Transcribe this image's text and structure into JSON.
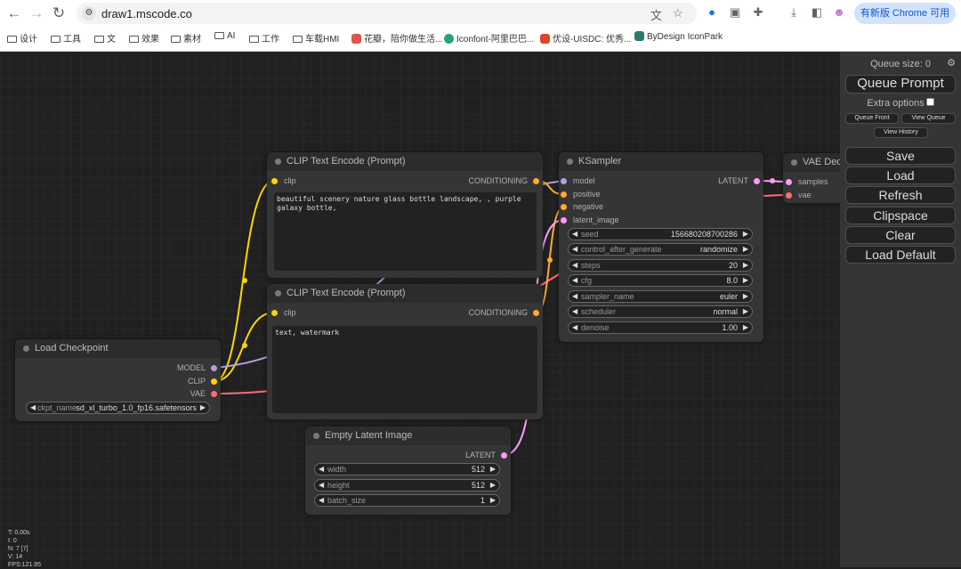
{
  "browser": {
    "url": "draw1.mscode.co",
    "update_label": "有新版 Chrome 可用",
    "bookmarks": [
      {
        "label": "设计",
        "type": "folder"
      },
      {
        "label": "工具",
        "type": "folder"
      },
      {
        "label": "文",
        "type": "folder"
      },
      {
        "label": "效果",
        "type": "folder"
      },
      {
        "label": "素材",
        "type": "folder"
      },
      {
        "label": "AI",
        "type": "folder"
      },
      {
        "label": "工作",
        "type": "folder"
      },
      {
        "label": "车载HMI",
        "type": "folder"
      },
      {
        "label": "花瓣，陪你做生活...",
        "type": "site",
        "color": "#e4504a"
      },
      {
        "label": "Iconfont-阿里巴巴...",
        "type": "site",
        "color": "#2aa37a"
      },
      {
        "label": "优设-UISDC: 优秀...",
        "type": "site",
        "color": "#d8472a"
      },
      {
        "label": "ByDesign IconPark",
        "type": "site",
        "color": "#2c7a6b"
      }
    ]
  },
  "nodes": {
    "clip1": {
      "title": "CLIP Text Encode (Prompt)",
      "input": "clip",
      "output": "CONDITIONING",
      "text": "beautiful scenery nature glass bottle landscape, , purple galaxy bottle,"
    },
    "clip2": {
      "title": "CLIP Text Encode (Prompt)",
      "input": "clip",
      "output": "CONDITIONING",
      "text": "text, watermark"
    },
    "ksampler": {
      "title": "KSampler",
      "inputs": [
        "model",
        "positive",
        "negative",
        "latent_image"
      ],
      "output": "LATENT",
      "widgets": [
        {
          "name": "seed",
          "value": "156680208700286"
        },
        {
          "name": "control_after_generate",
          "value": "randomize"
        },
        {
          "name": "steps",
          "value": "20"
        },
        {
          "name": "cfg",
          "value": "8.0"
        },
        {
          "name": "sampler_name",
          "value": "euler"
        },
        {
          "name": "scheduler",
          "value": "normal"
        },
        {
          "name": "denoise",
          "value": "1.00"
        }
      ]
    },
    "checkpoint": {
      "title": "Load Checkpoint",
      "outputs": [
        "MODEL",
        "CLIP",
        "VAE"
      ],
      "widget": {
        "name": "ckpt_name",
        "value": "sd_xl_turbo_1.0_fp16.safetensors"
      }
    },
    "latent": {
      "title": "Empty Latent Image",
      "output": "LATENT",
      "widgets": [
        {
          "name": "width",
          "value": "512"
        },
        {
          "name": "height",
          "value": "512"
        },
        {
          "name": "batch_size",
          "value": "1"
        }
      ]
    },
    "vae": {
      "title": "VAE Dec",
      "inputs": [
        "samples",
        "vae"
      ]
    }
  },
  "menu": {
    "queue_size": "Queue size: 0",
    "queue_prompt": "Queue Prompt",
    "extra_options": "Extra options",
    "queue_front": "Queue Front",
    "view_queue": "View Queue",
    "view_history": "View History",
    "save": "Save",
    "load": "Load",
    "refresh": "Refresh",
    "clipspace": "Clipspace",
    "clear": "Clear",
    "load_default": "Load Default"
  },
  "stats": [
    "T: 0.00s",
    "I: 0",
    "N: 7 [7]",
    "V: 14",
    "FPS:121.95"
  ],
  "colors": {
    "clip": "#ffd500",
    "model": "#b39ddb",
    "vae": "#ff6e6e",
    "latent": "#ff9cf9",
    "conditioning": "#ffa931"
  }
}
